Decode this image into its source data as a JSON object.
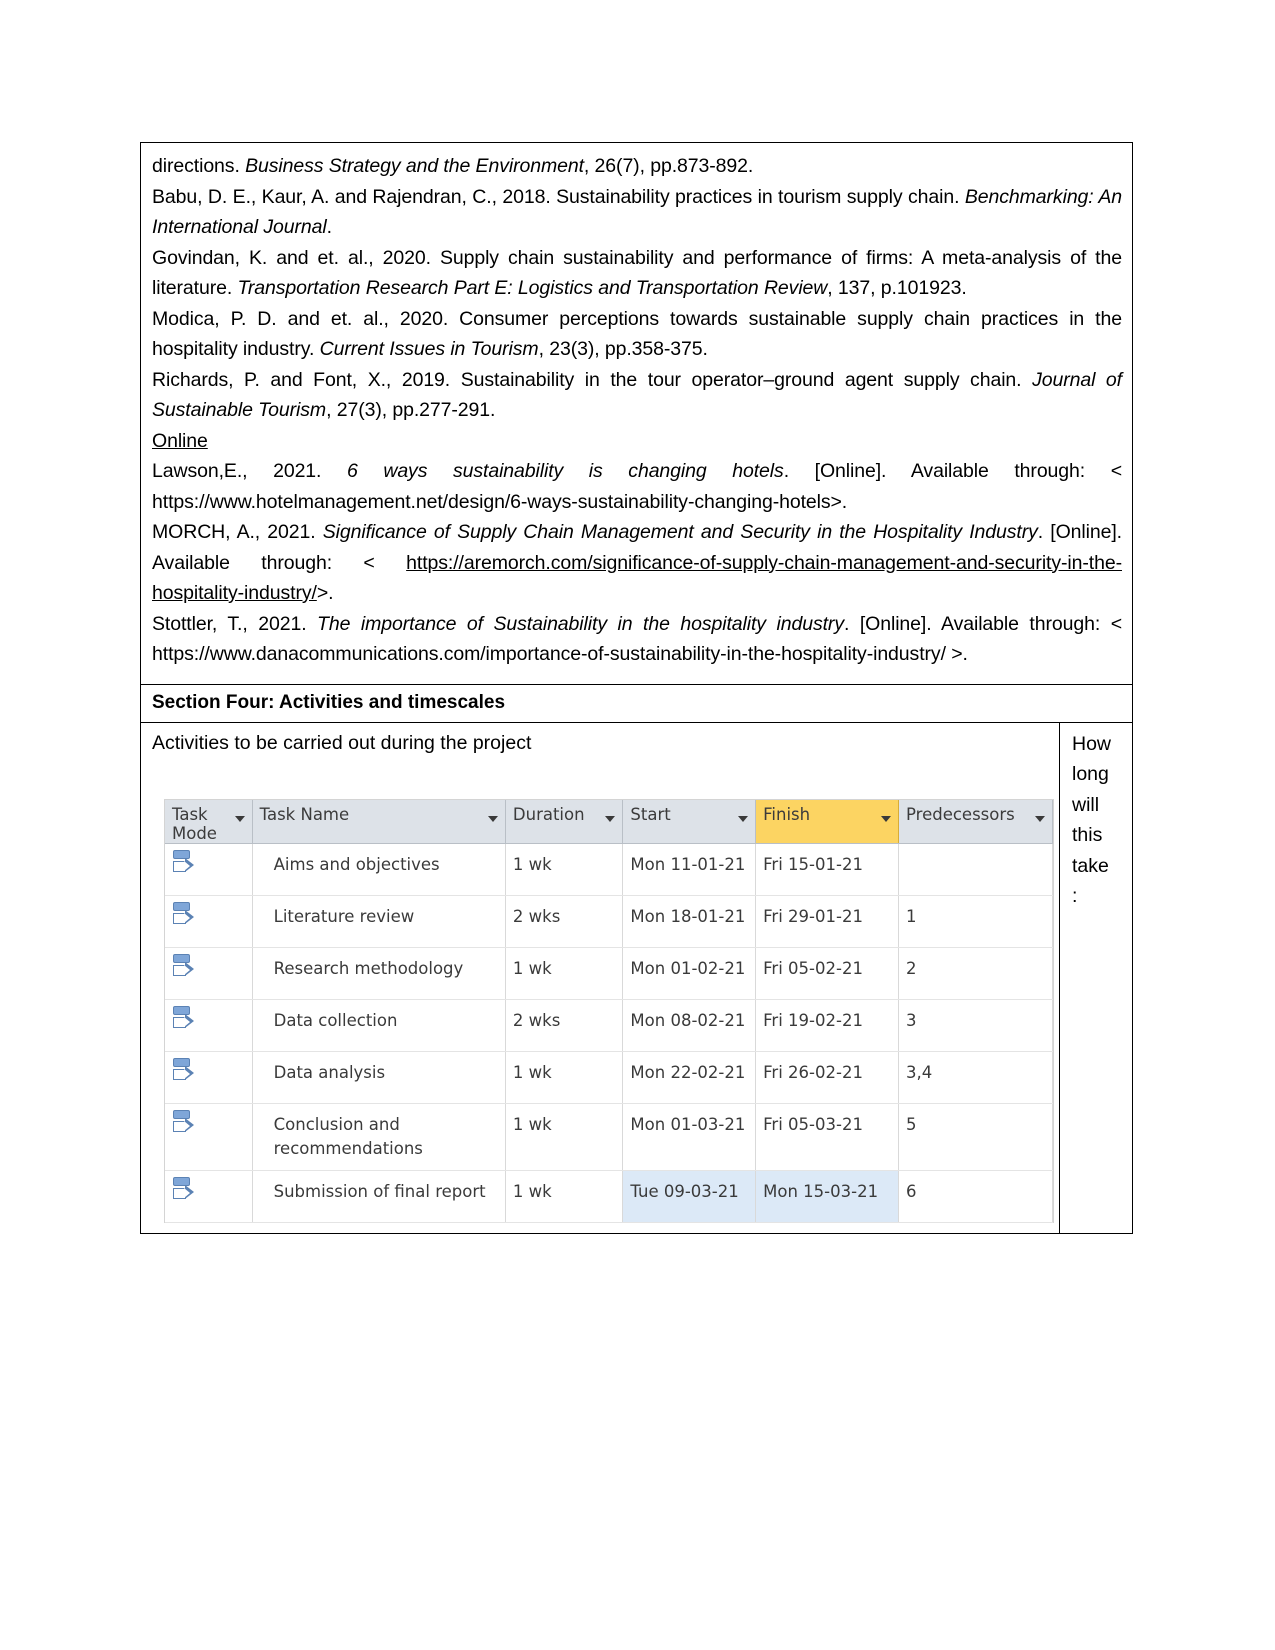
{
  "references": {
    "items": [
      {
        "id": "ref-business-strategy",
        "segments": [
          {
            "t": "directions. ",
            "style": "normal"
          },
          {
            "t": "Business Strategy and the Environment",
            "style": "italic"
          },
          {
            "t": ", 26(7), pp.873-892.",
            "style": "normal"
          }
        ]
      },
      {
        "id": "ref-babu",
        "segments": [
          {
            "t": "Babu, D. E., Kaur, A. and Rajendran, C., 2018. Sustainability practices in tourism supply chain. ",
            "style": "normal"
          },
          {
            "t": "Benchmarking: An International Journal",
            "style": "italic"
          },
          {
            "t": ".",
            "style": "normal"
          }
        ]
      },
      {
        "id": "ref-govindan",
        "segments": [
          {
            "t": "Govindan, K. and et. al., 2020. Supply chain sustainability and performance of firms: A meta-analysis of the literature. ",
            "style": "normal"
          },
          {
            "t": "Transportation Research Part E: Logistics and Transportation Review",
            "style": "italic"
          },
          {
            "t": ", 137, p.101923.",
            "style": "normal"
          }
        ]
      },
      {
        "id": "ref-modica",
        "segments": [
          {
            "t": "Modica, P. D. and et. al., 2020. Consumer perceptions towards sustainable supply chain practices in the hospitality industry. ",
            "style": "normal"
          },
          {
            "t": "Current Issues in Tourism",
            "style": "italic"
          },
          {
            "t": ", 23(3), pp.358-375.",
            "style": "normal"
          }
        ]
      },
      {
        "id": "ref-richards",
        "segments": [
          {
            "t": "Richards, P. and Font, X., 2019. Sustainability in the tour operator–ground agent supply chain. ",
            "style": "normal"
          },
          {
            "t": "Journal of Sustainable Tourism",
            "style": "italic"
          },
          {
            "t": ", 27(3), pp.277-291.",
            "style": "normal"
          }
        ]
      }
    ],
    "online_heading": "Online",
    "online_items": [
      {
        "id": "ref-lawson",
        "segments": [
          {
            "t": "Lawson,E., 2021. ",
            "style": "normal"
          },
          {
            "t": "6 ways sustainability is changing hotels",
            "style": "italic"
          },
          {
            "t": ". [Online]. Available through: < https://www.hotelmanagement.net/design/6-ways-sustainability-changing-hotels>.",
            "style": "normal"
          }
        ]
      },
      {
        "id": "ref-morch",
        "segments": [
          {
            "t": "MORCH, A., 2021. ",
            "style": "normal"
          },
          {
            "t": "Significance of Supply Chain Management and Security in the Hospitality Industry",
            "style": "italic"
          },
          {
            "t": ". [Online]. Available through: < ",
            "style": "normal"
          },
          {
            "t": "https://aremorch.com/significance-of-supply-chain-management-and-security-in-the-hospitality-industry/",
            "style": "link"
          },
          {
            "t": ">.",
            "style": "normal"
          }
        ]
      },
      {
        "id": "ref-stottler",
        "segments": [
          {
            "t": "Stottler, T., 2021. ",
            "style": "normal"
          },
          {
            "t": "The importance of Sustainability in the hospitality industry",
            "style": "italic"
          },
          {
            "t": ". [Online]. Available through: < https://www.danacommunications.com/importance-of-sustainability-in-the-hospitality-industry/ >.",
            "style": "normal"
          }
        ]
      }
    ]
  },
  "section_four": {
    "heading": "Section Four: Activities and timescales",
    "activities_label": "Activities to be carried out during the project",
    "side_prompt_lines": [
      "How",
      "long",
      "will",
      "this",
      "take",
      ":"
    ]
  },
  "project_grid": {
    "columns": [
      {
        "key": "task_mode",
        "label": "Task Mode",
        "highlight": false
      },
      {
        "key": "task_name",
        "label": "Task Name",
        "highlight": false
      },
      {
        "key": "duration",
        "label": "Duration",
        "highlight": false
      },
      {
        "key": "start",
        "label": "Start",
        "highlight": false
      },
      {
        "key": "finish",
        "label": "Finish",
        "highlight": true
      },
      {
        "key": "predecessors",
        "label": "Predecessors",
        "highlight": false
      }
    ],
    "header_highlight_color": "#FCD462",
    "header_background_color": "#DDE2E8",
    "selection_color": "#DCE9F7",
    "task_mode_icon": "auto-schedule-icon",
    "rows": [
      {
        "task_name": "Aims and objectives",
        "duration": "1 wk",
        "start": "Mon 11-01-21",
        "finish": "Fri 15-01-21",
        "predecessors": "",
        "selected": false
      },
      {
        "task_name": "Literature review",
        "duration": "2 wks",
        "start": "Mon 18-01-21",
        "finish": "Fri 29-01-21",
        "predecessors": "1",
        "selected": false
      },
      {
        "task_name": "Research methodology",
        "duration": "1 wk",
        "start": "Mon 01-02-21",
        "finish": "Fri 05-02-21",
        "predecessors": "2",
        "selected": false
      },
      {
        "task_name": "Data collection",
        "duration": "2 wks",
        "start": "Mon 08-02-21",
        "finish": "Fri 19-02-21",
        "predecessors": "3",
        "selected": false
      },
      {
        "task_name": "Data analysis",
        "duration": "1 wk",
        "start": "Mon 22-02-21",
        "finish": "Fri 26-02-21",
        "predecessors": "3,4",
        "selected": false
      },
      {
        "task_name": "Conclusion and recommendations",
        "duration": "1 wk",
        "start": "Mon 01-03-21",
        "finish": "Fri 05-03-21",
        "predecessors": "5",
        "selected": false
      },
      {
        "task_name": "Submission of final report",
        "duration": "1 wk",
        "start": "Tue 09-03-21",
        "finish": "Mon 15-03-21",
        "predecessors": "6",
        "selected": true
      }
    ]
  }
}
